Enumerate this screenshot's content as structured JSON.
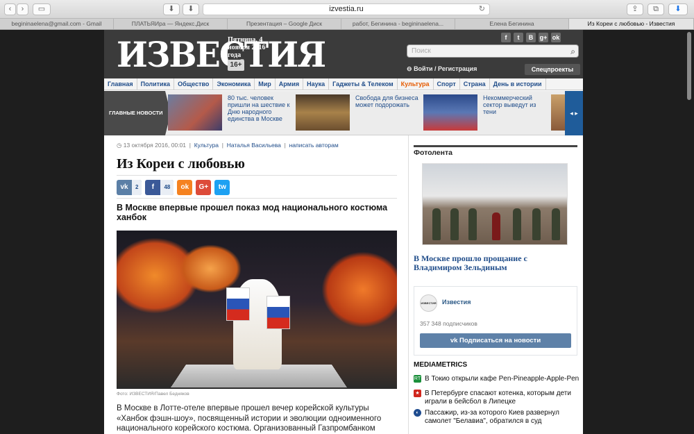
{
  "browser": {
    "url": "izvestia.ru",
    "tabs": [
      {
        "label": "begininaelena@gmail.com - Gmail"
      },
      {
        "label": "ПЛАТЬЯИра — Яндекс.Диск"
      },
      {
        "label": "Презентация – Google Диск"
      },
      {
        "label": "работ, Бегинина - begininaelena..."
      },
      {
        "label": "Елена Бегинина"
      },
      {
        "label": "Из Кореи с любовью - Известия"
      }
    ],
    "active_tab": 5
  },
  "masthead": {
    "logo": "ИЗВЕСТИЯ",
    "date": "Пятница, 4 ноября 2016 года",
    "age": "16+",
    "social": [
      "f",
      "t",
      "B",
      "g+",
      "ok"
    ],
    "search_placeholder": "Поиск",
    "login": "Войти / Регистрация",
    "special": "Спецпроекты"
  },
  "nav": [
    "Главная",
    "Политика",
    "Общество",
    "Экономика",
    "Мир",
    "Армия",
    "Наука",
    "Гаджеты & Телеком",
    "Культура",
    "Спорт",
    "Страна",
    "День в истории"
  ],
  "nav_highlight": "Культура",
  "strip": {
    "label": "ГЛАВНЫЕ НОВОСТИ",
    "items": [
      {
        "text": "80 тыс. человек пришли на шествие к Дню народного единства в Москве"
      },
      {
        "text": "Свобода для бизнеса может подорожать"
      },
      {
        "text": "Некоммерческий сектор выведут из тени"
      }
    ]
  },
  "article": {
    "date": "13 октября 2016, 00:01",
    "rubric": "Культура",
    "author": "Наталья Васильева",
    "write_authors": "написать авторам",
    "title": "Из Кореи с любовью",
    "shares": [
      {
        "icon": "vk",
        "count": "2",
        "color": "#5b7fa6"
      },
      {
        "icon": "f",
        "count": "48",
        "color": "#3b5998"
      },
      {
        "icon": "ok",
        "count": "",
        "color": "#f58220"
      },
      {
        "icon": "G+",
        "count": "",
        "color": "#dd4b39"
      },
      {
        "icon": "tw",
        "count": "",
        "color": "#1da1f2"
      }
    ],
    "lead": "В Москве впервые прошел показ мод национального костюма ханбок",
    "caption": "Фото: ИЗВЕСТИЯ/Павел Бедняков",
    "body": "В Москве в Лотте-отеле впервые прошел вечер корейской культуры «Ханбок фэшн-шоу», посвященный истории и эволюции одноименного национального корейского костюма. Организованный Газпромбанком совместно с корейской компанией Daelim вечер стал"
  },
  "photolenta": {
    "heading": "Фотолента",
    "caption": "В Москве прошло прощание с Владимиром Зельдиным"
  },
  "vk_widget": {
    "logo": "ИЗВЕСТИЯ",
    "name": "Известия",
    "subscribers": "357 348 подписчиков",
    "button": "Подписаться на новости"
  },
  "mediametrics": {
    "heading": "MEDIAMETRICS",
    "items": [
      {
        "text": "В Токио открыли кафе Pen-Pineapple-Apple-Pen",
        "icon_color": "#1a8f3a"
      },
      {
        "text": "В Петербурге спасают котенка, которым дети играли в бейсбол в Липецке",
        "icon_color": "#d0261d"
      },
      {
        "text": "Пассажир, из-за которого Киев развернул самолет \"Белавиа\", обратился в суд",
        "icon_color": "#1f4c8f"
      }
    ]
  }
}
